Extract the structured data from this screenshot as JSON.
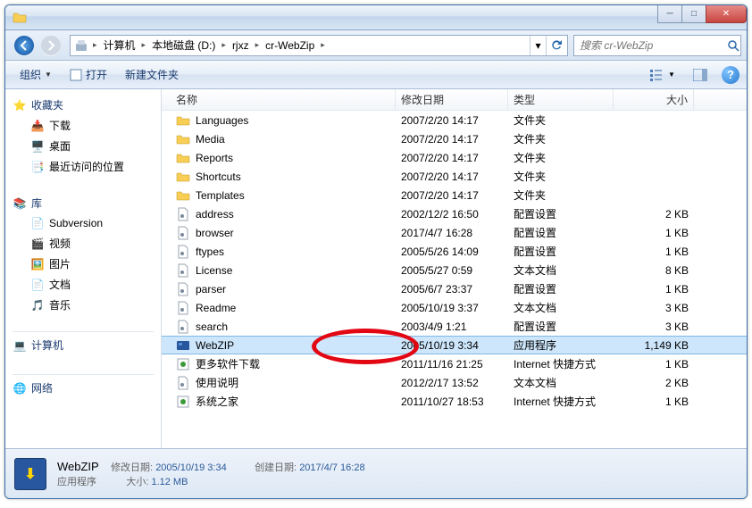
{
  "breadcrumb": [
    "计算机",
    "本地磁盘 (D:)",
    "rjxz",
    "cr-WebZip"
  ],
  "search_placeholder": "搜索 cr-WebZip",
  "toolbar": {
    "organize": "组织",
    "open": "打开",
    "new_folder": "新建文件夹"
  },
  "sidebar": {
    "favorites": {
      "label": "收藏夹",
      "items": [
        "下载",
        "桌面",
        "最近访问的位置"
      ]
    },
    "libraries": {
      "label": "库",
      "items": [
        "Subversion",
        "视频",
        "图片",
        "文档",
        "音乐"
      ]
    },
    "computer": {
      "label": "计算机"
    },
    "network": {
      "label": "网络"
    }
  },
  "columns": {
    "name": "名称",
    "date": "修改日期",
    "type": "类型",
    "size": "大小"
  },
  "files": [
    {
      "icon": "folder",
      "name": "Languages",
      "date": "2007/2/20 14:17",
      "type": "文件夹",
      "size": ""
    },
    {
      "icon": "folder",
      "name": "Media",
      "date": "2007/2/20 14:17",
      "type": "文件夹",
      "size": ""
    },
    {
      "icon": "folder",
      "name": "Reports",
      "date": "2007/2/20 14:17",
      "type": "文件夹",
      "size": ""
    },
    {
      "icon": "folder",
      "name": "Shortcuts",
      "date": "2007/2/20 14:17",
      "type": "文件夹",
      "size": ""
    },
    {
      "icon": "folder",
      "name": "Templates",
      "date": "2007/2/20 14:17",
      "type": "文件夹",
      "size": ""
    },
    {
      "icon": "ini",
      "name": "address",
      "date": "2002/12/2 16:50",
      "type": "配置设置",
      "size": "2 KB"
    },
    {
      "icon": "ini",
      "name": "browser",
      "date": "2017/4/7 16:28",
      "type": "配置设置",
      "size": "1 KB"
    },
    {
      "icon": "ini",
      "name": "ftypes",
      "date": "2005/5/26 14:09",
      "type": "配置设置",
      "size": "1 KB"
    },
    {
      "icon": "txt",
      "name": "License",
      "date": "2005/5/27 0:59",
      "type": "文本文档",
      "size": "8 KB"
    },
    {
      "icon": "ini",
      "name": "parser",
      "date": "2005/6/7 23:37",
      "type": "配置设置",
      "size": "1 KB"
    },
    {
      "icon": "txt",
      "name": "Readme",
      "date": "2005/10/19 3:37",
      "type": "文本文档",
      "size": "3 KB"
    },
    {
      "icon": "ini",
      "name": "search",
      "date": "2003/4/9 1:21",
      "type": "配置设置",
      "size": "3 KB"
    },
    {
      "icon": "exe",
      "name": "WebZIP",
      "date": "2005/10/19 3:34",
      "type": "应用程序",
      "size": "1,149 KB",
      "selected": true
    },
    {
      "icon": "url",
      "name": "更多软件下载",
      "date": "2011/11/16 21:25",
      "type": "Internet 快捷方式",
      "size": "1 KB"
    },
    {
      "icon": "txt",
      "name": "使用说明",
      "date": "2012/2/17 13:52",
      "type": "文本文档",
      "size": "2 KB"
    },
    {
      "icon": "url",
      "name": "系统之家",
      "date": "2011/10/27 18:53",
      "type": "Internet 快捷方式",
      "size": "1 KB"
    }
  ],
  "details": {
    "name": "WebZIP",
    "type": "应用程序",
    "mod_label": "修改日期:",
    "mod_val": "2005/10/19 3:34",
    "create_label": "创建日期:",
    "create_val": "2017/4/7 16:28",
    "size_label": "大小:",
    "size_val": "1.12 MB"
  }
}
